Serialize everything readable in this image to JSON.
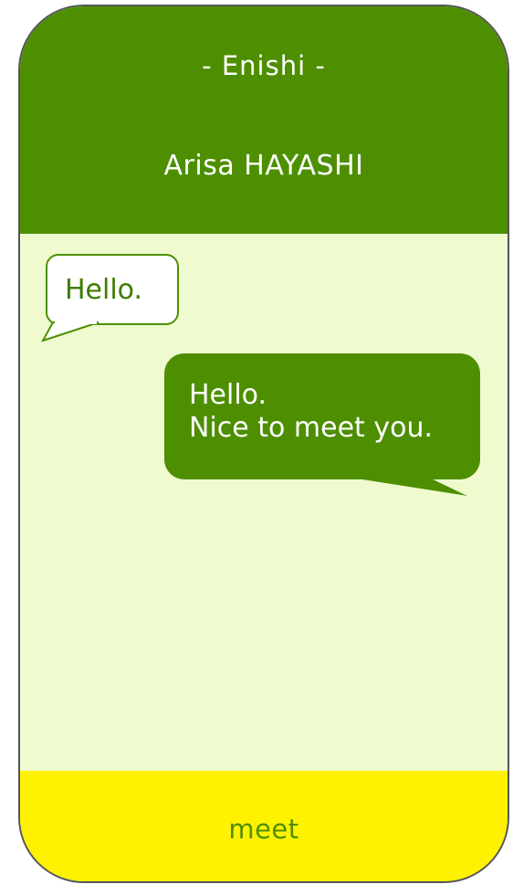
{
  "header": {
    "app_title": "- Enishi -",
    "contact_name": "Arisa HAYASHI"
  },
  "messages": [
    {
      "direction": "incoming",
      "lines": [
        "Hello."
      ]
    },
    {
      "direction": "outgoing",
      "lines": [
        "Hello.",
        "Nice to meet you."
      ]
    }
  ],
  "footer": {
    "action_label": "meet"
  },
  "colors": {
    "header_bg": "#4d8f00",
    "chat_bg": "#effbcf",
    "footer_bg": "#fff200",
    "accent_green": "#4d8f00",
    "outline": "#555555"
  }
}
